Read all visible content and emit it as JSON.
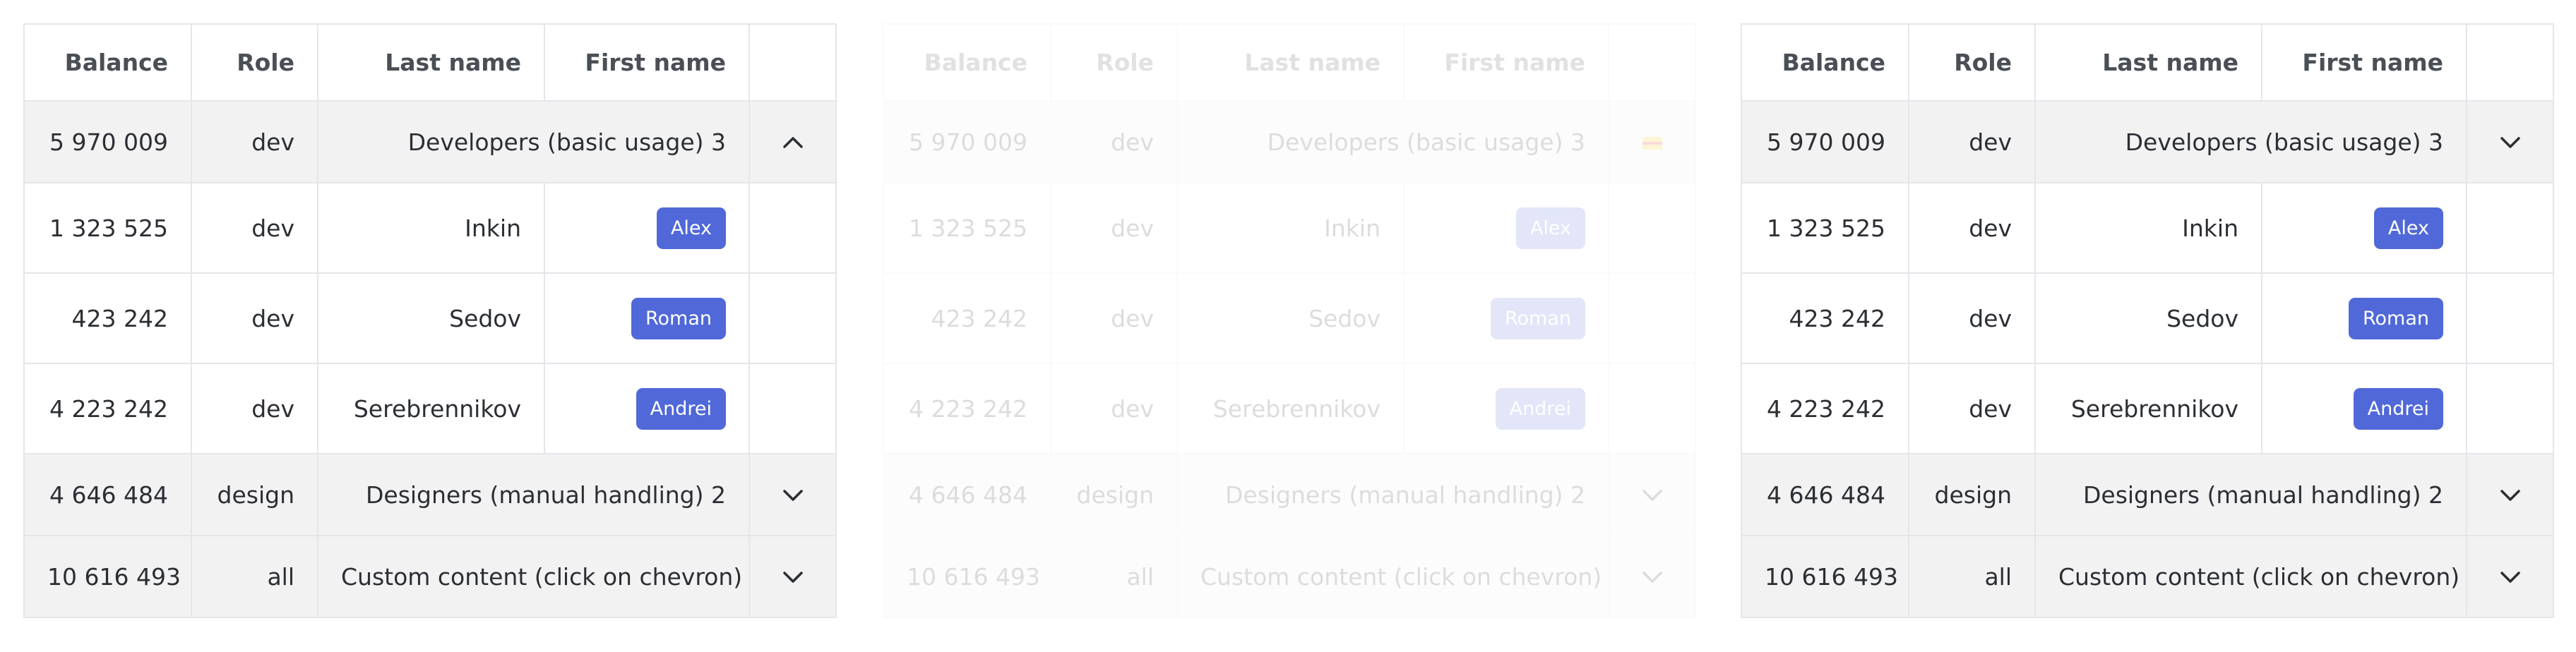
{
  "columns": [
    "Balance",
    "Role",
    "Last name",
    "First name"
  ],
  "panels": [
    {
      "groups": [
        {
          "balance": "5 970 009",
          "role": "dev",
          "label": "Developers (basic usage) 3",
          "chevron": "up",
          "expanded": true
        },
        {
          "balance": "4 646 484",
          "role": "design",
          "label": "Designers (manual handling) 2",
          "chevron": "down",
          "expanded": false
        },
        {
          "balance": "10 616 493",
          "role": "all",
          "label": "Custom content (click on chevron)",
          "chevron": "down",
          "expanded": false
        }
      ]
    },
    {
      "faded": true,
      "groups": [
        {
          "balance": "5 970 009",
          "role": "dev",
          "label": "Developers (basic usage) 3",
          "chevron": "flag",
          "expanded": true
        },
        {
          "balance": "4 646 484",
          "role": "design",
          "label": "Designers (manual handling) 2",
          "chevron": "down",
          "expanded": false
        },
        {
          "balance": "10 616 493",
          "role": "all",
          "label": "Custom content (click on chevron)",
          "chevron": "down",
          "expanded": false
        }
      ]
    },
    {
      "groups": [
        {
          "balance": "5 970 009",
          "role": "dev",
          "label": "Developers (basic usage) 3",
          "chevron": "down",
          "expanded": true
        },
        {
          "balance": "4 646 484",
          "role": "design",
          "label": "Designers (manual handling) 2",
          "chevron": "down",
          "expanded": false
        },
        {
          "balance": "10 616 493",
          "role": "all",
          "label": "Custom content (click on chevron)",
          "chevron": "down",
          "expanded": false
        }
      ]
    }
  ],
  "developers": [
    {
      "balance": "1 323 525",
      "role": "dev",
      "last_name": "Inkin",
      "first_name": "Alex"
    },
    {
      "balance": "423 242",
      "role": "dev",
      "last_name": "Sedov",
      "first_name": "Roman"
    },
    {
      "balance": "4 223 242",
      "role": "dev",
      "last_name": "Serebrennikov",
      "first_name": "Andrei"
    }
  ],
  "colors": {
    "accent": "#5068d8",
    "group_row_bg": "#f2f2f3",
    "border": "#e4e6ea",
    "text": "#2b2e33"
  },
  "icons": {
    "up": "chevron-up-icon",
    "down": "chevron-down-icon",
    "flag": "flag-icon"
  }
}
